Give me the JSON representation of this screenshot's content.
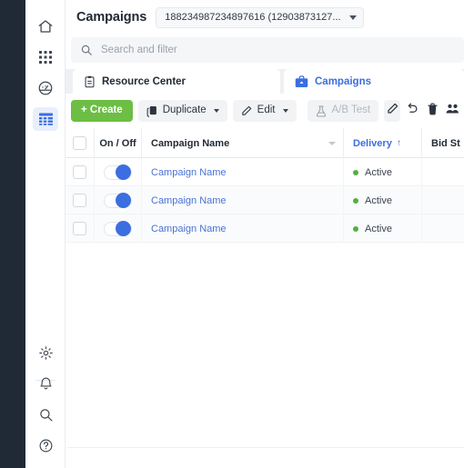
{
  "sidebar": {
    "top_items": [
      {
        "name": "home-icon",
        "label": "Home",
        "active": false
      },
      {
        "name": "apps-grid-icon",
        "label": "Apps",
        "active": false
      },
      {
        "name": "dashboard-gauge-icon",
        "label": "Dashboard",
        "active": false
      },
      {
        "name": "table-grid-icon",
        "label": "Campaigns",
        "active": true
      }
    ],
    "bottom_items": [
      {
        "name": "gear-icon",
        "label": "Settings"
      },
      {
        "name": "bell-icon",
        "label": "Notifications"
      },
      {
        "name": "search-icon",
        "label": "Search"
      },
      {
        "name": "help-circle-icon",
        "label": "Help"
      }
    ]
  },
  "header": {
    "title": "Campaigns",
    "account_selector": {
      "value": "188234987234897616 (12903873127...",
      "icon": "chevron-down-icon"
    }
  },
  "search": {
    "placeholder": "Search and filter",
    "value": "",
    "icon": "search-icon"
  },
  "tabs": [
    {
      "label": "Resource Center",
      "icon": "clipboard-icon",
      "active": false
    },
    {
      "label": "Campaigns",
      "icon": "briefcase-icon",
      "active": true
    }
  ],
  "toolbar": {
    "create_label": "+ Create",
    "duplicate_label": "Duplicate",
    "duplicate_icon": "copy-icon",
    "edit_label": "Edit",
    "edit_icon": "pencil-icon",
    "abtest_label": "A/B Test",
    "abtest_icon": "flask-icon",
    "abtest_disabled": true,
    "icon_buttons": [
      {
        "name": "pencil-icon",
        "label": "Edit",
        "filled": true
      },
      {
        "name": "undo-icon",
        "label": "Undo",
        "filled": false
      },
      {
        "name": "trash-icon",
        "label": "Delete",
        "filled": false
      },
      {
        "name": "audience-icon",
        "label": "Audience",
        "filled": false
      }
    ]
  },
  "table": {
    "columns": [
      {
        "key": "check",
        "label": "",
        "sorted": false
      },
      {
        "key": "onoff",
        "label": "On / Off",
        "sorted": false
      },
      {
        "key": "name",
        "label": "Campaign Name",
        "sorted": false
      },
      {
        "key": "delivery",
        "label": "Delivery",
        "sorted": true,
        "sort_arrow": "↑"
      },
      {
        "key": "bid",
        "label": "Bid St",
        "sorted": false
      }
    ],
    "rows": [
      {
        "checked": false,
        "on": true,
        "name": "Campaign Name",
        "delivery": "Active",
        "bid": ""
      },
      {
        "checked": false,
        "on": true,
        "name": "Campaign Name",
        "delivery": "Active",
        "bid": ""
      },
      {
        "checked": false,
        "on": true,
        "name": "Campaign Name",
        "delivery": "Active",
        "bid": ""
      }
    ]
  },
  "colors": {
    "brand_green": "#6cbe45",
    "link_blue": "#4a73d6",
    "accent_blue": "#3b6ee0",
    "status_green": "#52b043",
    "dark_strip": "#1f2a36"
  }
}
